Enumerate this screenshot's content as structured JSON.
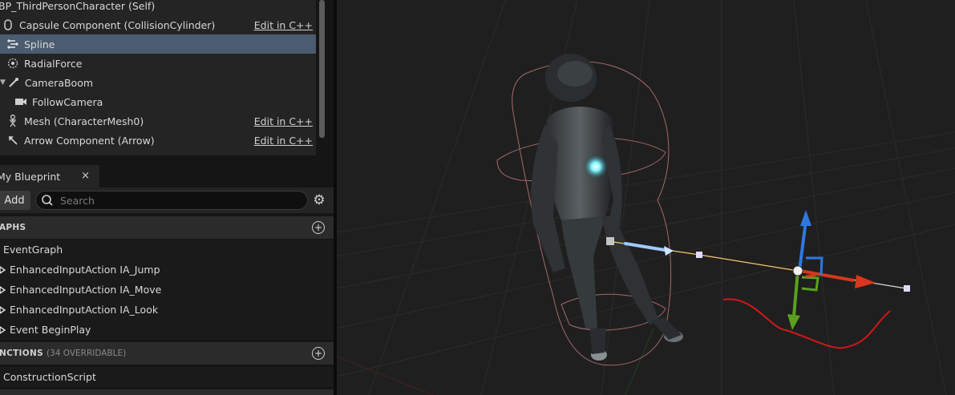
{
  "components": {
    "root_label": "BP_ThirdPersonCharacter (Self)",
    "items": [
      {
        "label": "Capsule Component (CollisionCylinder)",
        "edit": "Edit in C++",
        "icon": "capsule-icon"
      },
      {
        "label": "Spline",
        "edit": "",
        "icon": "spline-icon"
      },
      {
        "label": "RadialForce",
        "edit": "",
        "icon": "radial-force-icon"
      },
      {
        "label": "CameraBoom",
        "edit": "",
        "icon": "camera-boom-icon"
      },
      {
        "label": "FollowCamera",
        "edit": "",
        "icon": "camera-icon"
      },
      {
        "label": "Mesh (CharacterMesh0)",
        "edit": "Edit in C++",
        "icon": "skeleton-icon"
      },
      {
        "label": "Arrow Component (Arrow)",
        "edit": "Edit in C++",
        "icon": "arrow-icon"
      }
    ],
    "selected": "Spline"
  },
  "my_blueprint": {
    "tab_label": "My Blueprint",
    "close_glyph": "×",
    "add_label": "Add",
    "search_placeholder": "Search",
    "graphs_header": "APHS",
    "graphs": [
      {
        "label": "EventGraph"
      },
      {
        "label": "EnhancedInputAction IA_Jump"
      },
      {
        "label": "EnhancedInputAction IA_Move"
      },
      {
        "label": "EnhancedInputAction IA_Look"
      },
      {
        "label": "Event BeginPlay"
      }
    ],
    "functions_header": "NCTIONS",
    "functions_sub": "(34 OVERRIDABLE)",
    "functions": [
      {
        "label": "ConstructionScript"
      }
    ]
  },
  "colors": {
    "selection": "#4b5c70",
    "gizmo_x": "#d9361d",
    "gizmo_y": "#5aa01e",
    "gizmo_z": "#2f78e0",
    "spline_line": "#f4c66b",
    "chest_glow": "#7ff4ff",
    "drawn_curve": "#d01818"
  }
}
